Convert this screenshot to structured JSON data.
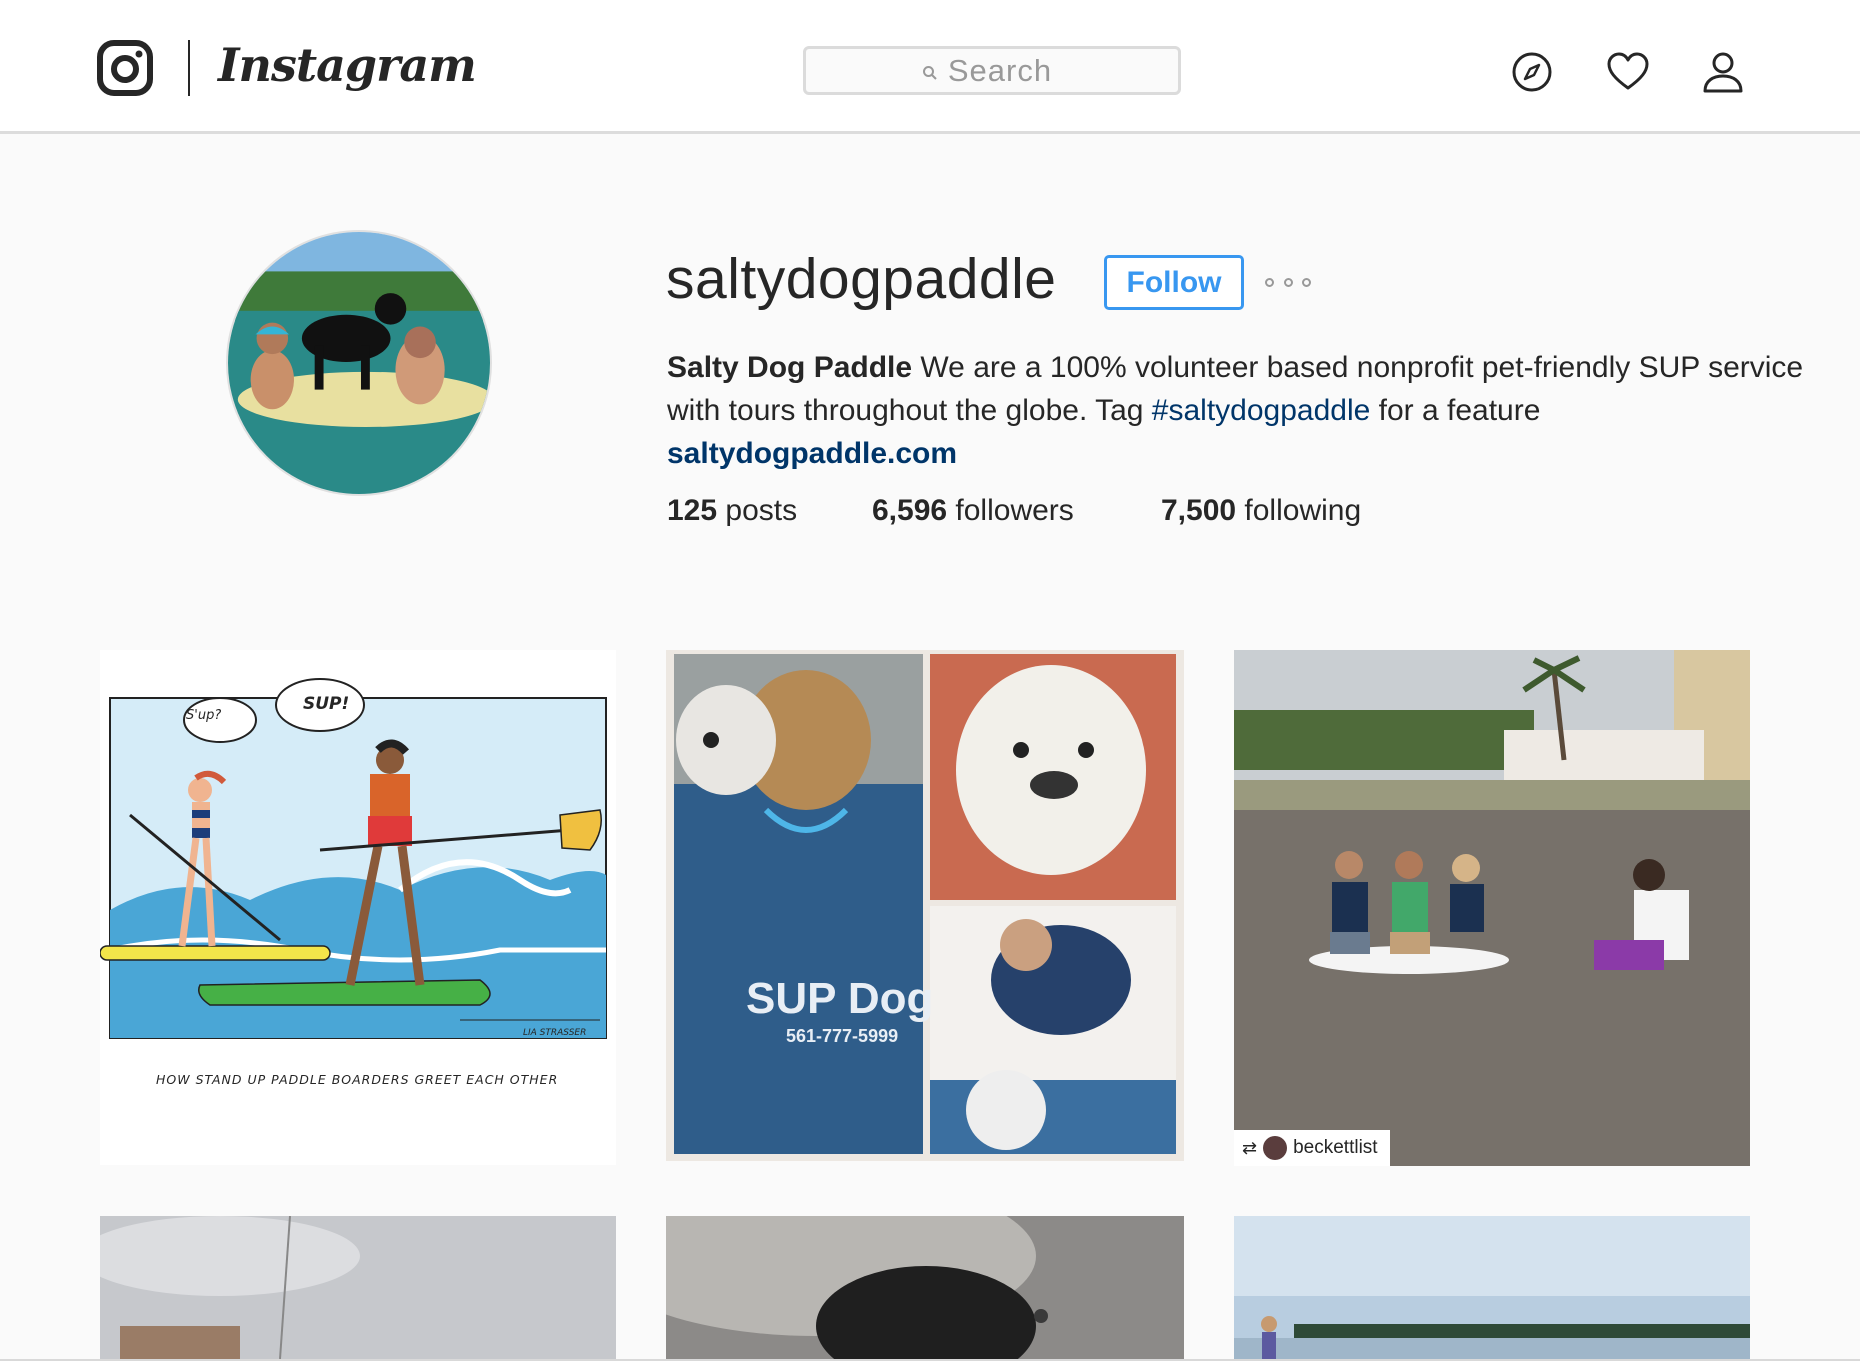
{
  "header": {
    "wordmark": "Instagram",
    "search_placeholder": "Search",
    "icons": [
      "instagram-glyph-icon",
      "search-icon",
      "compass-icon",
      "heart-icon",
      "user-icon"
    ]
  },
  "profile": {
    "username": "saltydogpaddle",
    "follow_label": "Follow",
    "full_name": "Salty Dog Paddle",
    "bio_text_1": " We are a 100% volunteer based nonprofit pet-friendly SUP service with tours throughout the globe. Tag ",
    "hashtag": "#saltydogpaddle",
    "bio_text_2": " for a feature",
    "website": "saltydogpaddle.com",
    "stats": {
      "posts_count": "125",
      "posts_label": " posts",
      "followers_count": "6,596",
      "followers_label": " followers",
      "following_count": "7,500",
      "following_label": " following"
    }
  },
  "posts": [
    {
      "id": "post-1",
      "bubble_1": "S'up?",
      "bubble_2": "SUP!",
      "caption": "HOW STAND UP PADDLE BOARDERS GREET EACH OTHER",
      "signature": "LIA STRASSER"
    },
    {
      "id": "post-2",
      "shirt_text": "SUP Dog",
      "shirt_phone": "561-777-5999"
    },
    {
      "id": "post-3",
      "repost_user": "beckettlist"
    },
    {
      "id": "post-4"
    },
    {
      "id": "post-5"
    },
    {
      "id": "post-6"
    }
  ],
  "colors": {
    "accent_blue": "#3897f0",
    "link_dark_blue": "#003569",
    "text": "#262626",
    "background": "#fafafa"
  }
}
